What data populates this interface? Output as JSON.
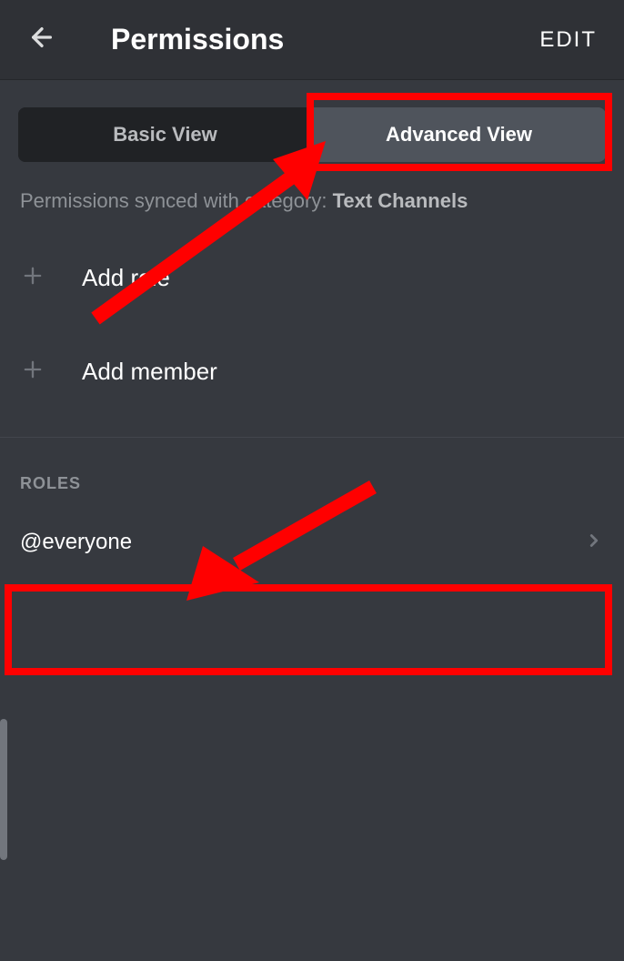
{
  "header": {
    "title": "Permissions",
    "edit_label": "EDIT"
  },
  "tabs": {
    "basic": "Basic View",
    "advanced": "Advanced View"
  },
  "sync": {
    "text": "Permissions synced with category: ",
    "category": "Text Channels"
  },
  "actions": {
    "add_role": "Add role",
    "add_member": "Add member"
  },
  "sections": {
    "roles_header": "ROLES"
  },
  "roles": [
    {
      "name": "@everyone"
    }
  ]
}
